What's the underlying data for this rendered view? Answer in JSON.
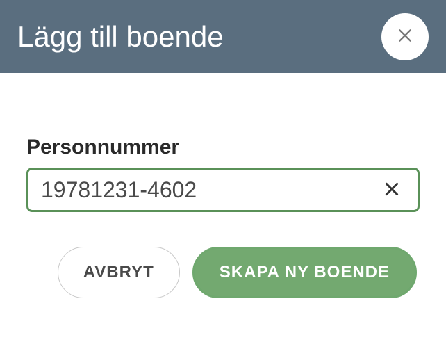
{
  "header": {
    "title": "Lägg till boende"
  },
  "form": {
    "personnummer_label": "Personnummer",
    "personnummer_value": "19781231-4602"
  },
  "buttons": {
    "cancel_label": "AVBRYT",
    "create_label": "SKAPA NY BOENDE"
  }
}
